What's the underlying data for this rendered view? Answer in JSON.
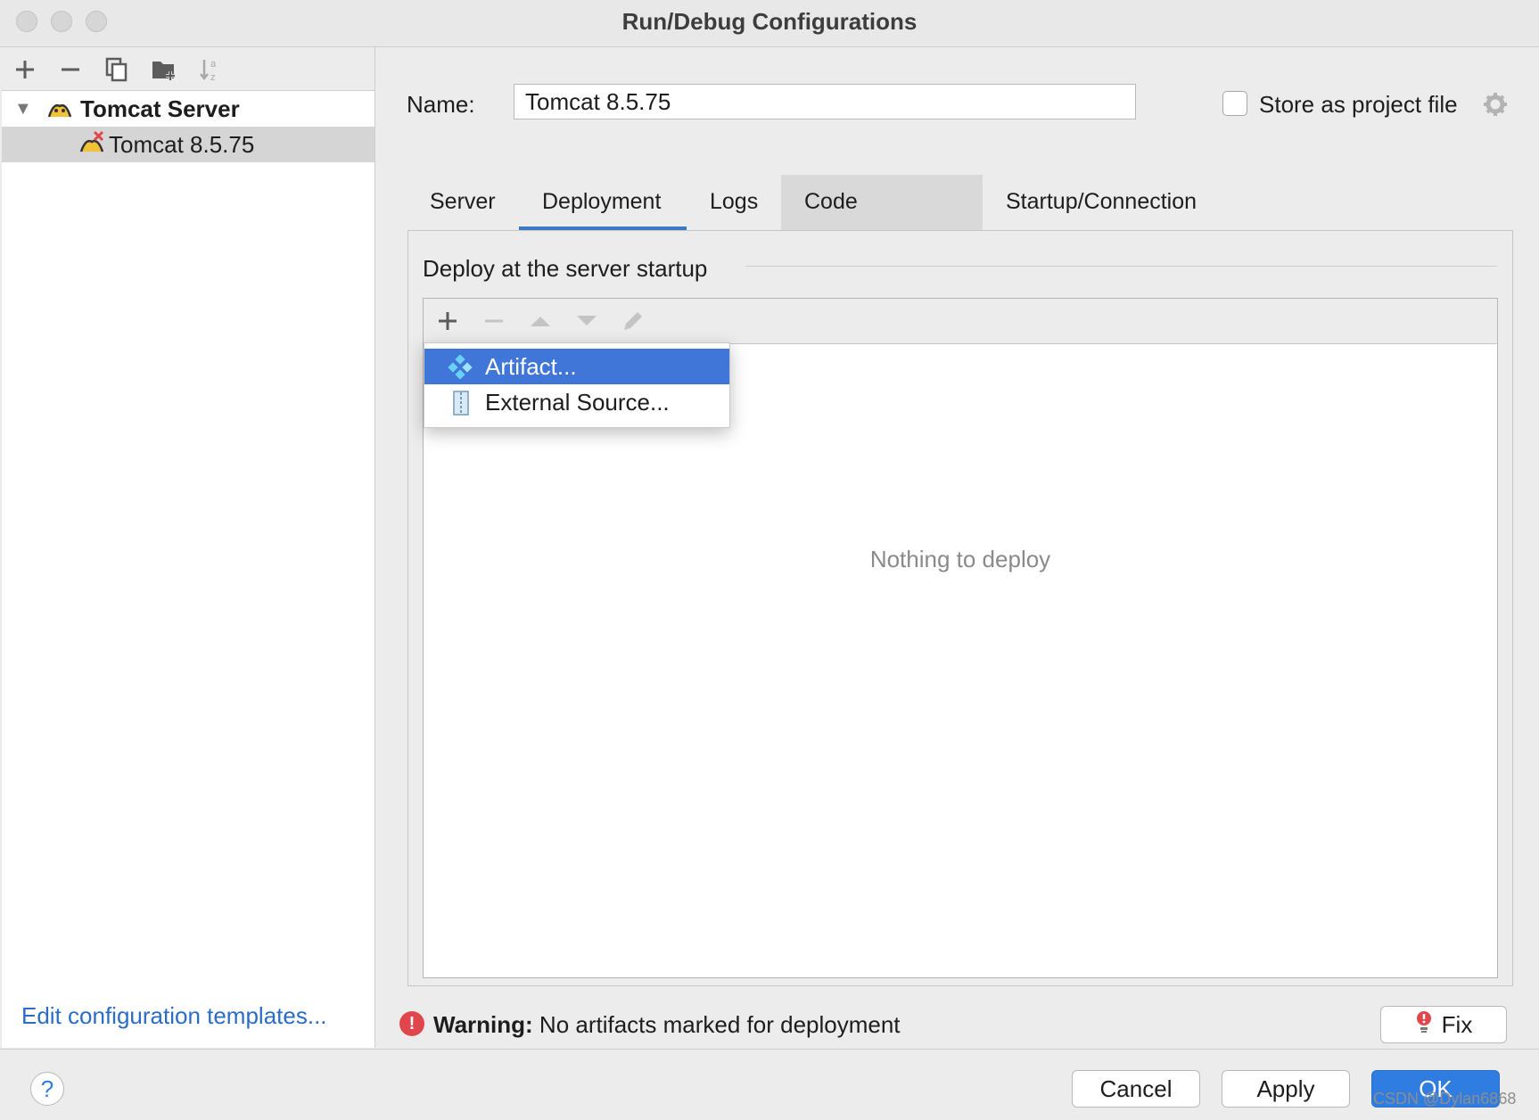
{
  "window": {
    "title": "Run/Debug Configurations"
  },
  "left_panel": {
    "toolbar_icons": [
      "plus-icon",
      "minus-icon",
      "copy-icon",
      "folder-add-icon",
      "sort-az-icon"
    ],
    "tree": {
      "group": "Tomcat Server",
      "item": "Tomcat 8.5.75"
    },
    "edit_templates_link": "Edit configuration templates..."
  },
  "config": {
    "name_label": "Name:",
    "name_value": "Tomcat 8.5.75",
    "store_label": "Store as project file",
    "store_checked": false
  },
  "tabs": [
    {
      "label": "Server",
      "active": false
    },
    {
      "label": "Deployment",
      "active": true
    },
    {
      "label": "Logs",
      "active": false
    },
    {
      "label": "Code Coverage",
      "active": false,
      "hovered": true
    },
    {
      "label": "Startup/Connection",
      "active": false
    }
  ],
  "deployment": {
    "section_title": "Deploy at the server startup",
    "empty_text": "Nothing to deploy",
    "popup_items": [
      "Artifact...",
      "External Source..."
    ]
  },
  "warning": {
    "bold": "Warning:",
    "text": "No artifacts marked for deployment",
    "fix_label": "Fix"
  },
  "buttons": {
    "help": "?",
    "cancel": "Cancel",
    "apply": "Apply",
    "ok": "OK"
  },
  "watermark": "CSDN @Dylan6868",
  "colors": {
    "accent": "#3f76d8",
    "link": "#2b6cc4",
    "warning": "#e0474c"
  }
}
